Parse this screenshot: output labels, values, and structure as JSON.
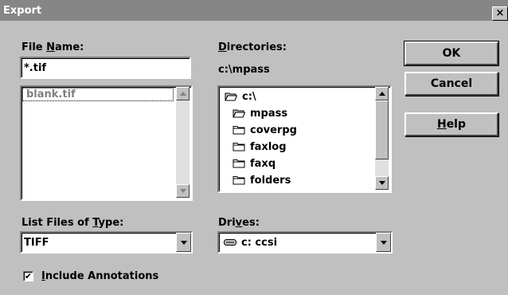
{
  "window": {
    "title": "Export",
    "close_glyph": "×"
  },
  "file_name": {
    "label_pre": "File ",
    "label_key": "N",
    "label_post": "ame:",
    "value": "*.tif",
    "files": [
      "blank.tif"
    ]
  },
  "directories": {
    "label_key": "D",
    "label_post": "irectories:",
    "current_path": "c:\\mpass",
    "items": [
      {
        "label": "c:\\",
        "icon": "open-folder-icon"
      },
      {
        "label": "mpass",
        "icon": "open-folder-icon"
      },
      {
        "label": "coverpg",
        "icon": "closed-folder-icon"
      },
      {
        "label": "faxlog",
        "icon": "closed-folder-icon"
      },
      {
        "label": "faxq",
        "icon": "closed-folder-icon"
      },
      {
        "label": "folders",
        "icon": "closed-folder-icon"
      }
    ]
  },
  "buttons": {
    "ok": "OK",
    "cancel": "Cancel",
    "help_key": "H",
    "help_post": "elp"
  },
  "file_type": {
    "label_pre": "List Files of ",
    "label_key": "T",
    "label_post": "ype:",
    "value": "TIFF"
  },
  "drives": {
    "label_pre": "Dri",
    "label_key": "v",
    "label_post": "es:",
    "value": "c: ccsi",
    "icon": "drive-icon"
  },
  "include_annotations": {
    "checked": true,
    "check_glyph": "✔",
    "label_key": "I",
    "label_post": "nclude Annotations"
  },
  "colors": {
    "face": "#c0c0c0",
    "title_bar": "#868686",
    "shadow": "#808080",
    "highlight": "#ffffff"
  }
}
